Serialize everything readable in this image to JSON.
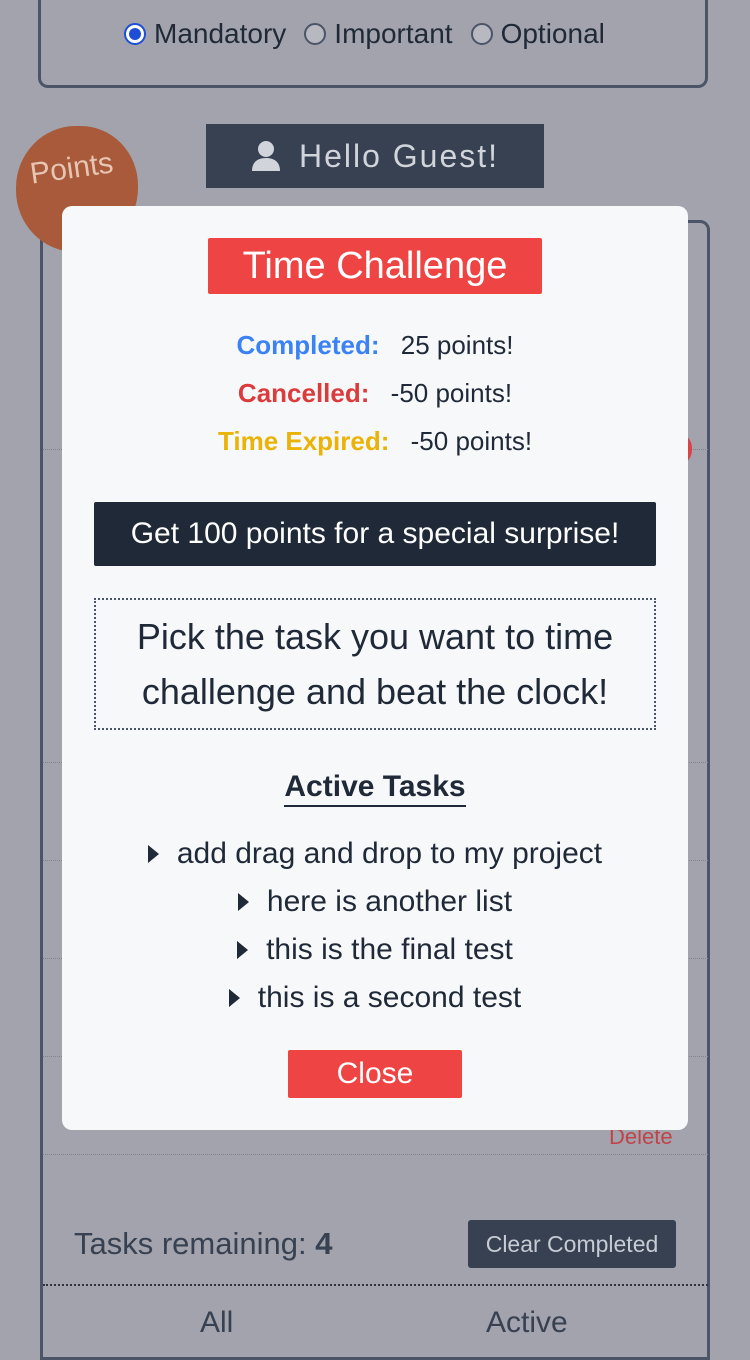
{
  "priority": {
    "options": [
      "Mandatory",
      "Important",
      "Optional"
    ],
    "selected": "Mandatory"
  },
  "header": {
    "greeting": "Hello Guest!",
    "points_badge": "Points"
  },
  "tasks_panel": {
    "delete_label": "Delete",
    "remaining_label": "Tasks remaining:",
    "remaining_count": "4",
    "clear_completed_label": "Clear Completed",
    "filters": [
      "All",
      "Active"
    ]
  },
  "modal": {
    "title": "Time Challenge",
    "scores": [
      {
        "label": "Completed:",
        "value": "25 points!",
        "color": "#3b82f6"
      },
      {
        "label": "Cancelled:",
        "value": "-50 points!",
        "color": "#dc3b3b"
      },
      {
        "label": "Time Expired:",
        "value": "-50 points!",
        "color": "#eab308"
      }
    ],
    "surprise_text": "Get 100 points for a special surprise!",
    "instruction": "Pick the task you want to time challenge and beat the clock!",
    "active_heading": "Active Tasks",
    "active_tasks": [
      "add drag and drop to my project",
      "here is another list",
      "this is the final test",
      "this is a second test"
    ],
    "close_label": "Close"
  },
  "colors": {
    "overlay": "#a2a3ac",
    "primary_dark": "#1f2937",
    "accent_red": "#ef4444"
  }
}
